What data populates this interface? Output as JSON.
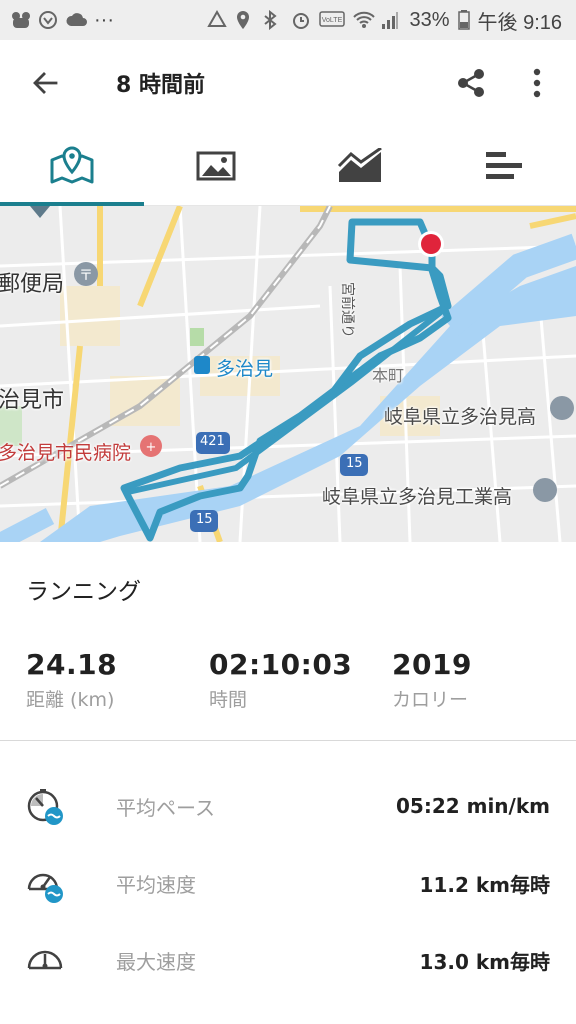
{
  "status_bar": {
    "battery": "33%",
    "time": "午後 9:16",
    "volte": "VoLTE"
  },
  "app_bar": {
    "title": "8 時間前"
  },
  "tabs": [
    {
      "name": "map-tab",
      "icon": "map-icon",
      "active": true
    },
    {
      "name": "photos-tab",
      "icon": "image-icon",
      "active": false
    },
    {
      "name": "charts-tab",
      "icon": "area-chart-icon",
      "active": false
    },
    {
      "name": "splits-tab",
      "icon": "bars-icon",
      "active": false
    }
  ],
  "map": {
    "labels": {
      "post_office": "郵便局",
      "station": "多治見",
      "city": "治見市",
      "hospital": "多治見市民病院",
      "honmachi": "本町",
      "school1": "岐阜県立多治見高",
      "school2": "岐阜県立多治見工業高",
      "street": "宮前通り",
      "route421": "421",
      "route15a": "15",
      "route15b": "15"
    },
    "route_color": "#3a9bc1",
    "marker_color": "#e0243b"
  },
  "activity": {
    "type": "ランニング",
    "distance_value": "24.18",
    "distance_label": "距離 (km)",
    "time_value": "02:10:03",
    "time_label": "時間",
    "calories_value": "2019",
    "calories_label": "カロリー"
  },
  "metrics": [
    {
      "label": "平均ペース",
      "value": "05:22 min/km",
      "icon": "pace-icon"
    },
    {
      "label": "平均速度",
      "value": "11.2 km毎時",
      "icon": "average-speed-icon"
    },
    {
      "label": "最大速度",
      "value": "13.0 km毎時",
      "icon": "max-speed-icon"
    }
  ],
  "colors": {
    "accent": "#1b7f8e",
    "secondary_text": "#9e9e9e"
  }
}
